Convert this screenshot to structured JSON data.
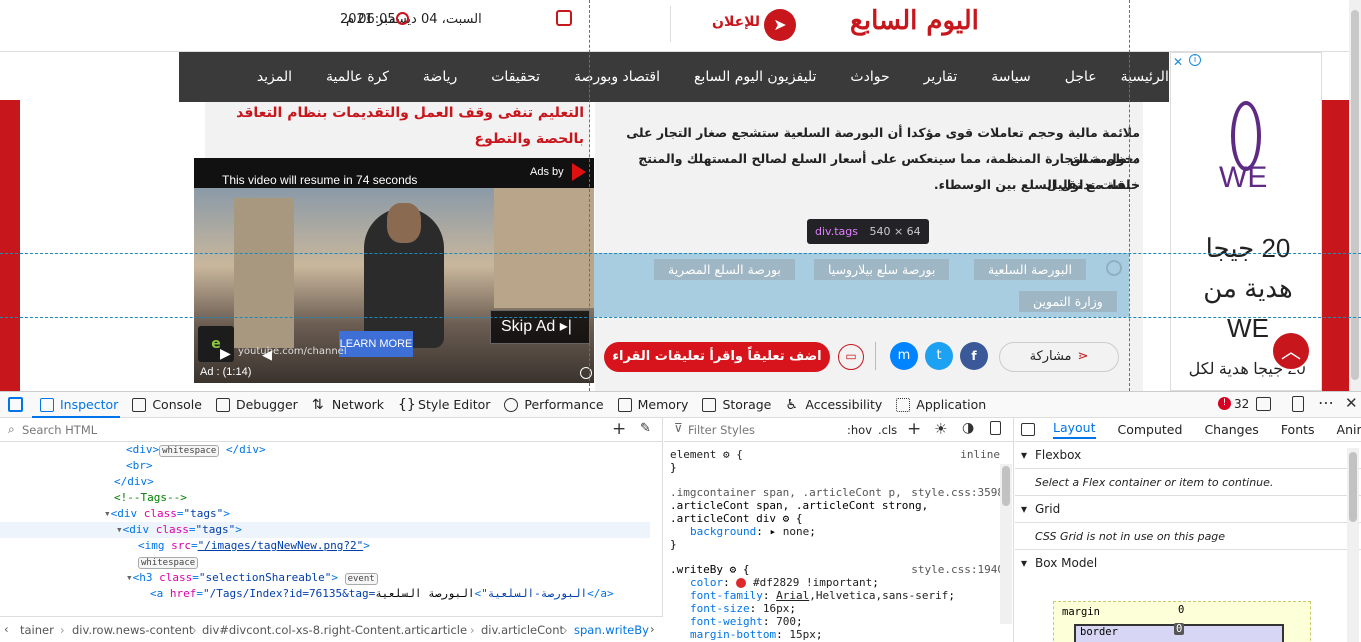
{
  "site": {
    "date": "السبت، 04 ديسمبر 2021",
    "time": "06:05 م",
    "advertise_label": "للإعلان",
    "logo_text": "اليوم السابع"
  },
  "nav": {
    "items": [
      "الرئيسية",
      "عاجل",
      "سياسة",
      "تقارير",
      "حوادث",
      "تليفزيون اليوم السابع",
      "اقتصاد وبورصة",
      "تحقيقات",
      "رياضة",
      "كرة عالمية",
      "المزيد"
    ]
  },
  "article": {
    "lines": [
      "ملائمة مالية وحجم تعاملات قوى مؤكدا أن البورصة السلعية ستشجع صغار التجار على دخول ضمن",
      "منظومة التجارة المنظمة، مما سينعكس على أسعار السلع لصالح المستهلك والمنتج خاصة مع تقليل",
      "حلقات تداول السلع بين الوسطاء."
    ],
    "tags": [
      "البورصة السلعية",
      "بورصة سلع بيلاروسيا",
      "بورصة السلع المصرية",
      "وزارة التموين"
    ],
    "share_label": "مشاركة",
    "comment_label": "اضف تعليقاً واقرأ تعليقات القراء"
  },
  "sidebar": {
    "headline": "التعليم تنفى وقف العمل والتقديمات بنظام التعاقد بالحصة والتطوع"
  },
  "video_ad": {
    "resume_text": "This video will resume in 74 seconds",
    "ads_by": "Ads by",
    "skip_label": "Skip Ad",
    "learn_more": "LEARN MORE",
    "ad_time": "Ad : (1:14)",
    "watermark": "youtube.com/channel"
  },
  "side_ad": {
    "brand": "WE",
    "promo": "20 جيجا هدية من WE",
    "promo_small": "20 جيجا هدية لكل"
  },
  "inspector_tooltip": {
    "tag": "div.tags",
    "size": "540 × 64"
  },
  "devtools": {
    "tabs": [
      "Inspector",
      "Console",
      "Debugger",
      "Network",
      "Style Editor",
      "Performance",
      "Memory",
      "Storage",
      "Accessibility",
      "Application"
    ],
    "error_count": "32",
    "search_placeholder": "Search HTML",
    "filter_placeholder": "Filter Styles",
    "hov": ":hov",
    "cls": ".cls",
    "layout_tabs": [
      "Layout",
      "Computed",
      "Changes",
      "Fonts",
      "Animat"
    ],
    "flexbox_title": "Flexbox",
    "flexbox_msg": "Select a Flex container or item to continue.",
    "grid_title": "Grid",
    "grid_msg": "CSS Grid is not in use on this page",
    "boxmodel_title": "Box Model",
    "box_margin": "margin",
    "box_border": "border",
    "box_zero": "0",
    "breadcrumbs": [
      "tainer",
      "div.row.news-content",
      "div#divcont.col-xs-8.right-Content.artic...",
      "article",
      "div.articleCont",
      "span.writeBy"
    ]
  },
  "colors": {
    "brand_red": "#c8161d",
    "nav_dark": "#3a3a3a",
    "devtools_blue": "#0074e8"
  }
}
